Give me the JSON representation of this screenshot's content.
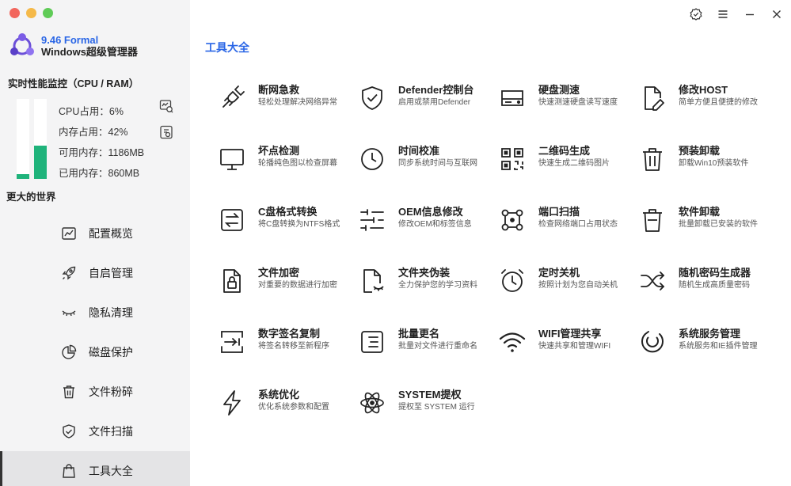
{
  "brand": {
    "version": "9.46 Formal",
    "name": "Windows超级管理器"
  },
  "perf": {
    "title": "实时性能监控（CPU / RAM）",
    "cpu_label": "CPU占用：6%",
    "mem_label": "内存占用：42%",
    "avail_label": "可用内存：1186MB",
    "used_label": "已用内存：860MB",
    "cpu_percent": 6,
    "mem_percent": 42
  },
  "slogan": "更大的世界",
  "nav": [
    {
      "label": "配置概览",
      "icon": "chart-icon"
    },
    {
      "label": "自启管理",
      "icon": "rocket-icon"
    },
    {
      "label": "隐私清理",
      "icon": "eye-closed-icon"
    },
    {
      "label": "磁盘保护",
      "icon": "pie-icon"
    },
    {
      "label": "文件粉碎",
      "icon": "trash-icon"
    },
    {
      "label": "文件扫描",
      "icon": "shield-icon"
    },
    {
      "label": "工具大全",
      "icon": "bag-icon",
      "active": true
    }
  ],
  "main": {
    "title": "工具大全"
  },
  "tools": [
    {
      "name": "断网急救",
      "desc": "轻松处理解决网络异常",
      "icon": "plug-icon"
    },
    {
      "name": "Defender控制台",
      "desc": "启用或禁用Defender",
      "icon": "shield-check-icon"
    },
    {
      "name": "硬盘测速",
      "desc": "快速测速硬盘读写速度",
      "icon": "disk-icon"
    },
    {
      "name": "修改HOST",
      "desc": "简单方便且便捷的修改",
      "icon": "edit-file-icon"
    },
    {
      "name": "坏点检测",
      "desc": "轮播纯色图以检查屏幕",
      "icon": "monitor-icon"
    },
    {
      "name": "时间校准",
      "desc": "同步系统时间与互联网",
      "icon": "clock-icon"
    },
    {
      "name": "二维码生成",
      "desc": "快速生成二维码图片",
      "icon": "qrcode-icon"
    },
    {
      "name": "预装卸载",
      "desc": "卸载Win10预装软件",
      "icon": "trash-icon"
    },
    {
      "name": "C盘格式转换",
      "desc": "将C盘转换为NTFS格式",
      "icon": "swap-icon"
    },
    {
      "name": "OEM信息修改",
      "desc": "修改OEM和标签信息",
      "icon": "sliders-icon"
    },
    {
      "name": "端口扫描",
      "desc": "检查网络端口占用状态",
      "icon": "scan-icon"
    },
    {
      "name": "软件卸载",
      "desc": "批量卸载已安装的软件",
      "icon": "trash-icon"
    },
    {
      "name": "文件加密",
      "desc": "对重要的数据进行加密",
      "icon": "lock-file-icon"
    },
    {
      "name": "文件夹伪装",
      "desc": "全力保护您的学习资料",
      "icon": "disguise-file-icon"
    },
    {
      "name": "定时关机",
      "desc": "按照计划为您自动关机",
      "icon": "alarm-icon"
    },
    {
      "name": "随机密码生成器",
      "desc": "随机生成高质量密码",
      "icon": "shuffle-icon"
    },
    {
      "name": "数字签名复制",
      "desc": "将签名转移至新程序",
      "icon": "signature-icon"
    },
    {
      "name": "批量更名",
      "desc": "批量对文件进行重命名",
      "icon": "rename-icon"
    },
    {
      "name": "WIFI管理共享",
      "desc": "快速共享和管理WIFI",
      "icon": "wifi-icon"
    },
    {
      "name": "系统服务管理",
      "desc": "系统服务和IE插件管理",
      "icon": "service-icon"
    },
    {
      "name": "系统优化",
      "desc": "优化系统参数和配置",
      "icon": "bolt-icon"
    },
    {
      "name": "SYSTEM提权",
      "desc": "提权至 SYSTEM 运行",
      "icon": "atom-icon"
    }
  ],
  "colors": {
    "accent": "#2a66e6",
    "bar_fill": "#1fb37b"
  }
}
